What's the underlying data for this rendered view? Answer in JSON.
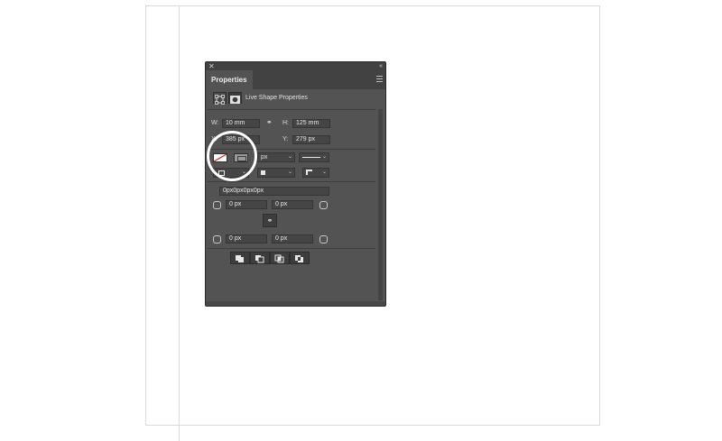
{
  "panel": {
    "tab_label": "Properties",
    "header_title": "Live Shape Properties",
    "icons": {
      "close": "close-icon",
      "collapse": "collapse-icon",
      "menu": "panel-menu-icon",
      "transform": "transform-icon",
      "mask": "mask-icon",
      "link": "link-icon"
    }
  },
  "transform": {
    "w_label": "W:",
    "w_value": "10 mm",
    "h_label": "H:",
    "h_value": "125 mm",
    "x_label": "X:",
    "x_value": "385 px",
    "y_label": "Y:",
    "y_value": "279 px"
  },
  "appearance": {
    "stroke_width_unit": "px",
    "fill_swatch": "none (red diagonal)",
    "stroke_swatch": "gray"
  },
  "corners": {
    "combined_value": "0px0px0px0px",
    "top_left": "0 px",
    "top_right": "0 px",
    "bottom_left": "0 px",
    "bottom_right": "0 px"
  },
  "pathfinder": [
    "combine-shapes-icon",
    "subtract-front-icon",
    "intersect-icon",
    "exclude-overlap-icon"
  ],
  "colors": {
    "panel_bg": "#535353",
    "panel_dark": "#424242",
    "field_bg": "#454545",
    "no_fill_red": "#d0302b",
    "highlight": "#ffffff"
  }
}
